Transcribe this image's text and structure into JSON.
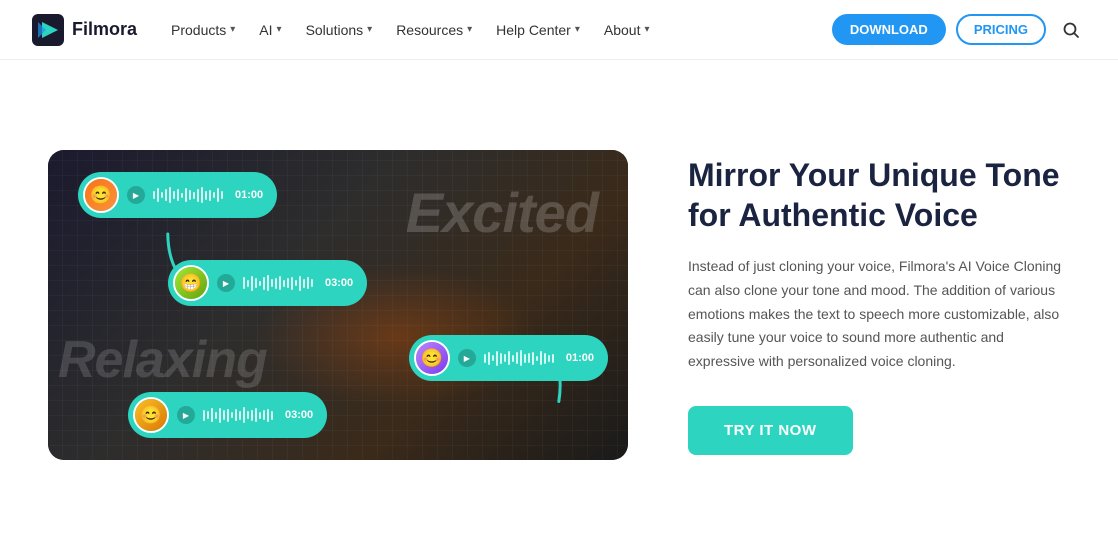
{
  "navbar": {
    "logo_text": "Filmora",
    "items": [
      {
        "label": "Products",
        "has_chevron": true
      },
      {
        "label": "AI",
        "has_chevron": true
      },
      {
        "label": "Solutions",
        "has_chevron": true
      },
      {
        "label": "Resources",
        "has_chevron": true
      },
      {
        "label": "Help Center",
        "has_chevron": true
      },
      {
        "label": "About",
        "has_chevron": true
      }
    ],
    "btn_download": "DOWNLOAD",
    "btn_pricing": "PRICING"
  },
  "hero": {
    "title": "Mirror Your Unique Tone for Authentic Voice",
    "description": "Instead of just cloning your voice, Filmora's AI Voice Cloning can also clone your tone and mood. The addition of various emotions makes the text to speech more customizable, also easily tune your voice to sound more authentic and expressive with personalized voice cloning.",
    "btn_try": "TRY IT NOW",
    "word_excited": "Excited",
    "word_relaxing": "Relaxing",
    "audio_cards": [
      {
        "time": "01:00",
        "emoji": "😊"
      },
      {
        "time": "03:00",
        "emoji": "😁"
      },
      {
        "time": "01:00",
        "emoji": "😊"
      },
      {
        "time": "03:00",
        "emoji": "😊"
      }
    ]
  }
}
